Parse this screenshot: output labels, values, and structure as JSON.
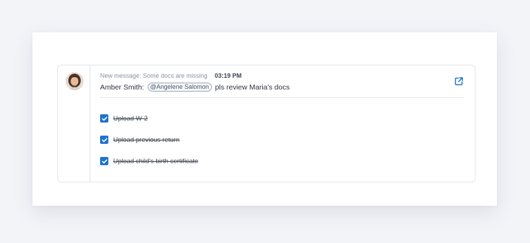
{
  "message": {
    "header": "New message: Some docs are missing",
    "time": "03:19 PM",
    "sender": "Amber Smith:",
    "mention": "@Angelene Salomon",
    "body": "pls review Maria's docs"
  },
  "tasks": [
    {
      "label": "Upload W-2",
      "checked": true
    },
    {
      "label": "Upload previous return",
      "checked": true
    },
    {
      "label": "Upload child's birth certificate",
      "checked": true
    }
  ],
  "icons": {
    "share": "share-external-icon",
    "check": "checkmark-icon"
  },
  "colors": {
    "accent": "#1f73d0",
    "muted": "#8a93a5",
    "text": "#2d3240"
  }
}
